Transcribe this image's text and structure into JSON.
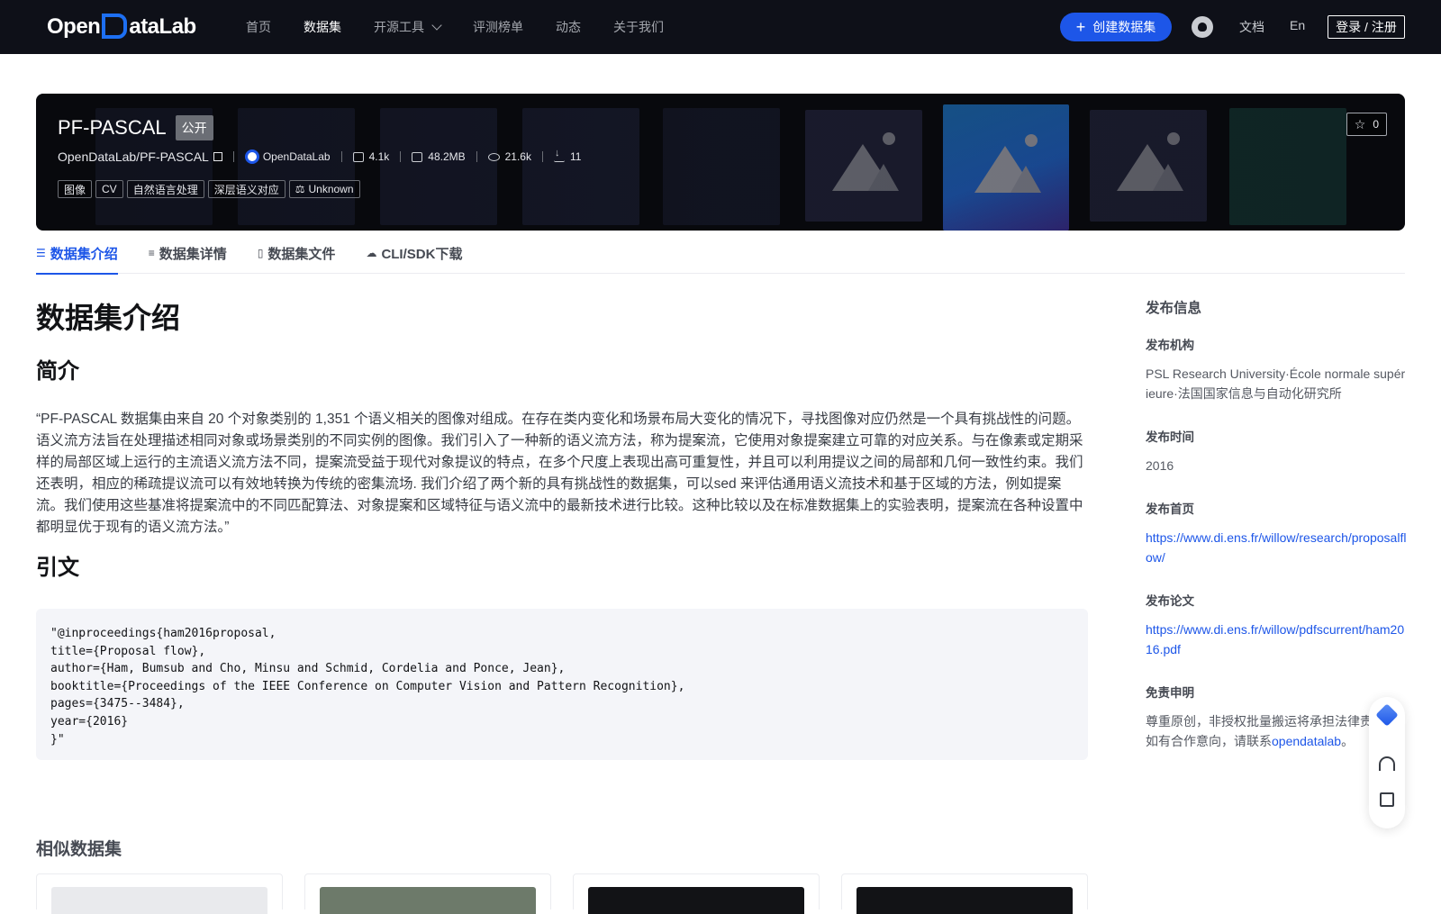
{
  "nav": {
    "logo": "OpenDataLab",
    "links": [
      "首页",
      "数据集",
      "开源工具",
      "评测榜单",
      "动态",
      "关于我们"
    ],
    "create_label": "创建数据集",
    "docs": "文档",
    "lang": "En",
    "login": "登录 / 注册"
  },
  "hero": {
    "title": "PF-PASCAL",
    "visibility": "公开",
    "repo": "OpenDataLab/PF-PASCAL",
    "org": "OpenDataLab",
    "stats": {
      "files": "4.1k",
      "size": "48.2MB",
      "views": "21.6k",
      "downloads": "11"
    },
    "tags": [
      "图像",
      "CV",
      "自然语言处理",
      "深层语义对应"
    ],
    "license": "Unknown",
    "stars": "0"
  },
  "tabs": [
    "数据集介绍",
    "数据集详情",
    "数据集文件",
    "CLI/SDK下载"
  ],
  "main": {
    "heading": "数据集介绍",
    "intro_heading": "简介",
    "intro": "“PF-PASCAL 数据集由来自 20 个对象类别的 1,351 个语义相关的图像对组成。在存在类内变化和场景布局大变化的情况下，寻找图像对应仍然是一个具有挑战性的问题。语义流方法旨在处理描述相同对象或场景类别的不同实例的图像。我们引入了一种新的语义流方法，称为提案流，它使用对象提案建立可靠的对应关系。与在像素或定期采样的局部区域上运行的主流语义流方法不同，提案流受益于现代对象提议的特点，在多个尺度上表现出高可重复性，并且可以利用提议之间的局部和几何一致性约束。我们还表明，相应的稀疏提议流可以有效地转换为传统的密集流场. 我们介绍了两个新的具有挑战性的数据集，可以sed 来评估通用语义流技术和基于区域的方法，例如提案流。我们使用这些基准将提案流中的不同匹配算法、对象提案和区域特征与语义流中的最新技术进行比较。这种比较以及在标准数据集上的实验表明，提案流在各种设置中都明显优于现有的语义流方法。”",
    "citation_heading": "引文",
    "citation": "\"@inproceedings{ham2016proposal,\ntitle={Proposal flow},\nauthor={Ham, Bumsub and Cho, Minsu and Schmid, Cordelia and Ponce, Jean},\nbooktitle={Proceedings of the IEEE Conference on Computer Vision and Pattern Recognition},\npages={3475--3484},\nyear={2016}\n}\"",
    "similar_heading": "相似数据集"
  },
  "sidebar": {
    "title": "发布信息",
    "org_label": "发布机构",
    "org": "PSL Research University·École normale supérieure·法国国家信息与自动化研究所",
    "time_label": "发布时间",
    "time": "2016",
    "home_label": "发布首页",
    "home": "https://www.di.ens.fr/willow/research/proposalflow/",
    "paper_label": "发布论文",
    "paper": "https://www.di.ens.fr/willow/pdfscurrent/ham2016.pdf",
    "disclaimer_label": "免责申明",
    "disclaimer_1": "尊重原创，非授权批量搬运将承担法律责任。如有合作意向，请联系",
    "disclaimer_link": "opendatalab",
    "disclaimer_2": "。"
  },
  "colors": {
    "accent": "#1d56e8",
    "nav_bg": "#0e1018"
  }
}
